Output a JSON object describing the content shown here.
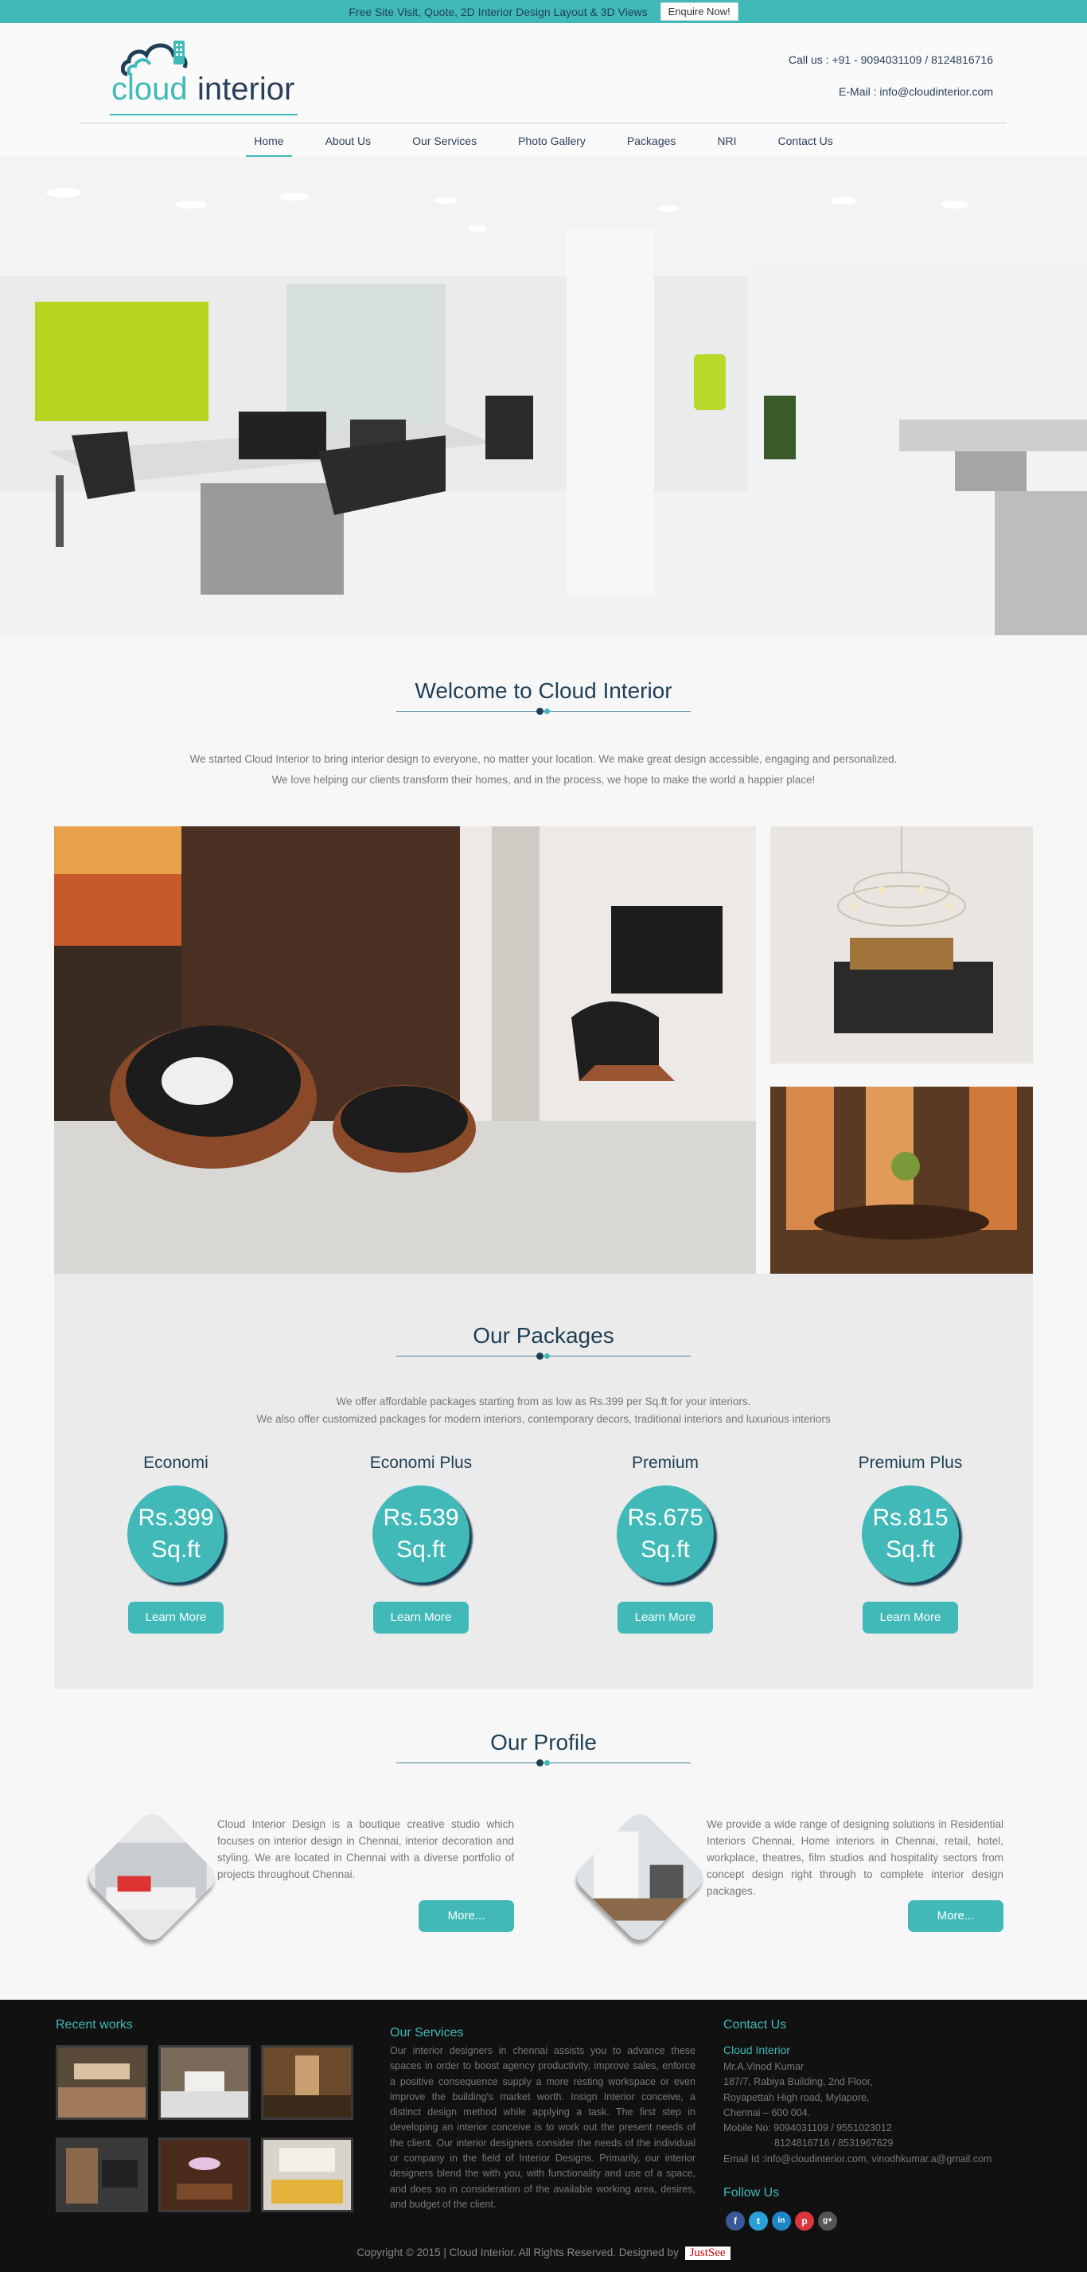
{
  "topbar": {
    "text": "Free Site Visit, Quote, 2D Interior Design Layout & 3D Views",
    "button": "Enquire Now!"
  },
  "header": {
    "logo_word1": "cloud",
    "logo_word2": "interior",
    "phone": "Call us : +91 - 9094031109 / 8124816716",
    "email": "E-Mail : info@cloudinterior.com"
  },
  "nav": [
    "Home",
    "About Us",
    "Our Services",
    "Photo Gallery",
    "Packages",
    "NRI",
    "Contact Us"
  ],
  "welcome": {
    "title": "Welcome to Cloud Interior",
    "line1": "We started Cloud Interior to bring interior design to everyone, no matter your location. We make great design accessible, engaging and personalized.",
    "line2": "We love helping our clients transform their homes, and in the process, we hope to make the world a happier place!"
  },
  "packages": {
    "title": "Our Packages",
    "line1": "We offer affordable packages starting from as low as Rs.399 per Sq.ft for your interiors.",
    "line2": "We also offer customized packages for modern interiors, contemporary decors, traditional interiors and luxurious interiors",
    "items": [
      {
        "name": "Economi",
        "price": "Rs.399",
        "unit": "Sq.ft",
        "button": "Learn More"
      },
      {
        "name": "Economi Plus",
        "price": "Rs.539",
        "unit": "Sq.ft",
        "button": "Learn More"
      },
      {
        "name": "Premium",
        "price": "Rs.675",
        "unit": "Sq.ft",
        "button": "Learn More"
      },
      {
        "name": "Premium Plus",
        "price": "Rs.815",
        "unit": "Sq.ft",
        "button": "Learn More"
      }
    ]
  },
  "profile": {
    "title": "Our Profile",
    "left_text": "Cloud Interior Design is a boutique creative studio which focuses on interior design in Chennai, interior decoration and styling. We are located in Chennai with a diverse portfolio of projects throughout Chennai.",
    "right_text": "We provide a wide range of designing solutions in Residential Interiors Chennai, Home interiors in Chennai, retail, hotel, workplace, theatres, film studios and hospitality sectors from concept design right through to complete interior design packages.",
    "button": "More..."
  },
  "footer": {
    "recent_title": "Recent works",
    "services_title": "Our Services",
    "services_text": "Our interior designers in chennai assists you to advance these spaces in order to boost agency productivity, improve sales, enforce a positive consequence supply a more resting workspace or even improve the building's market worth. Insign Interior conceive, a distinct design method while applying a task. The first step in developing an interior conceive is to work out the present needs of the client. Our interior designers consider the needs of the individual or company in the field of Interior Designs. Primarily, our interior designers blend the with you, with functionality and use of a space, and does so in consideration of the available working area, desires, and budget of the client.",
    "contact_title": "Contact Us",
    "company": "Cloud Interior",
    "person": "Mr.A.Vinod Kumar",
    "addr1": "187/7, Rabiya Building, 2nd Floor,",
    "addr2": "Royapettah High road, Mylapore,",
    "addr3": "Chennai – 600 004.",
    "mobile1": "Mobile No: 9094031109 / 9551023012",
    "mobile2": "8124816716 / 8531967629",
    "email": "Email Id :info@cloudinterior.com, vinodhkumar.a@gmail.com",
    "follow_title": "Follow Us",
    "social": [
      {
        "icon": "facebook-icon",
        "glyph": "f",
        "color": "#3b5998"
      },
      {
        "icon": "twitter-icon",
        "glyph": "t",
        "color": "#2ba0d8"
      },
      {
        "icon": "linkedin-icon",
        "glyph": "in",
        "color": "#1c86c6"
      },
      {
        "icon": "pinterest-icon",
        "glyph": "p",
        "color": "#d9363e"
      },
      {
        "icon": "google-plus-icon",
        "glyph": "g+",
        "color": "#555"
      }
    ],
    "copyright": "Copyright © 2015 | Cloud Interior. All Rights Reserved. Designed by",
    "designer": "JustSee"
  },
  "colors": {
    "accent": "#40b9b8",
    "navy": "#1e3f55",
    "footer_bg": "#111111"
  }
}
